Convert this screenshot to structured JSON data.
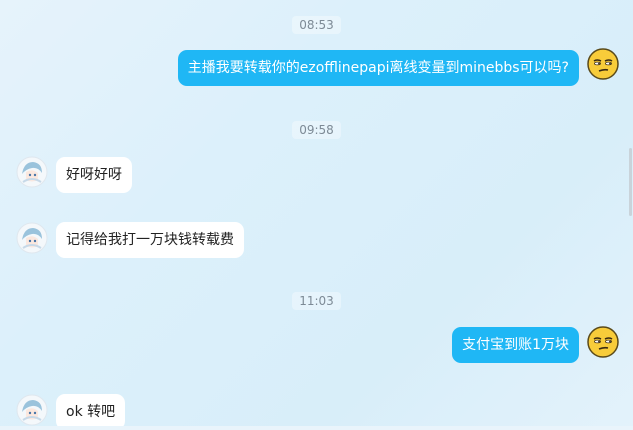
{
  "messages": [
    {
      "type": "time",
      "text": "08:53"
    },
    {
      "type": "outgoing",
      "text": "主播我要转载你的ezofflinepapi离线变量到minebbs可以吗?",
      "avatar": "smirk-emoji-avatar"
    },
    {
      "type": "time",
      "text": "09:58"
    },
    {
      "type": "incoming",
      "text": "好呀好呀",
      "avatar": "anime-girl-avatar"
    },
    {
      "type": "incoming",
      "text": "记得给我打一万块钱转载费",
      "avatar": "anime-girl-avatar"
    },
    {
      "type": "time",
      "text": "11:03"
    },
    {
      "type": "outgoing",
      "text": "支付宝到账1万块",
      "avatar": "smirk-emoji-avatar"
    },
    {
      "type": "incoming",
      "text": "ok 转吧",
      "avatar": "anime-girl-avatar"
    }
  ],
  "colors": {
    "outgoing_bubble": "#1fb7f5",
    "incoming_bubble": "#ffffff"
  }
}
